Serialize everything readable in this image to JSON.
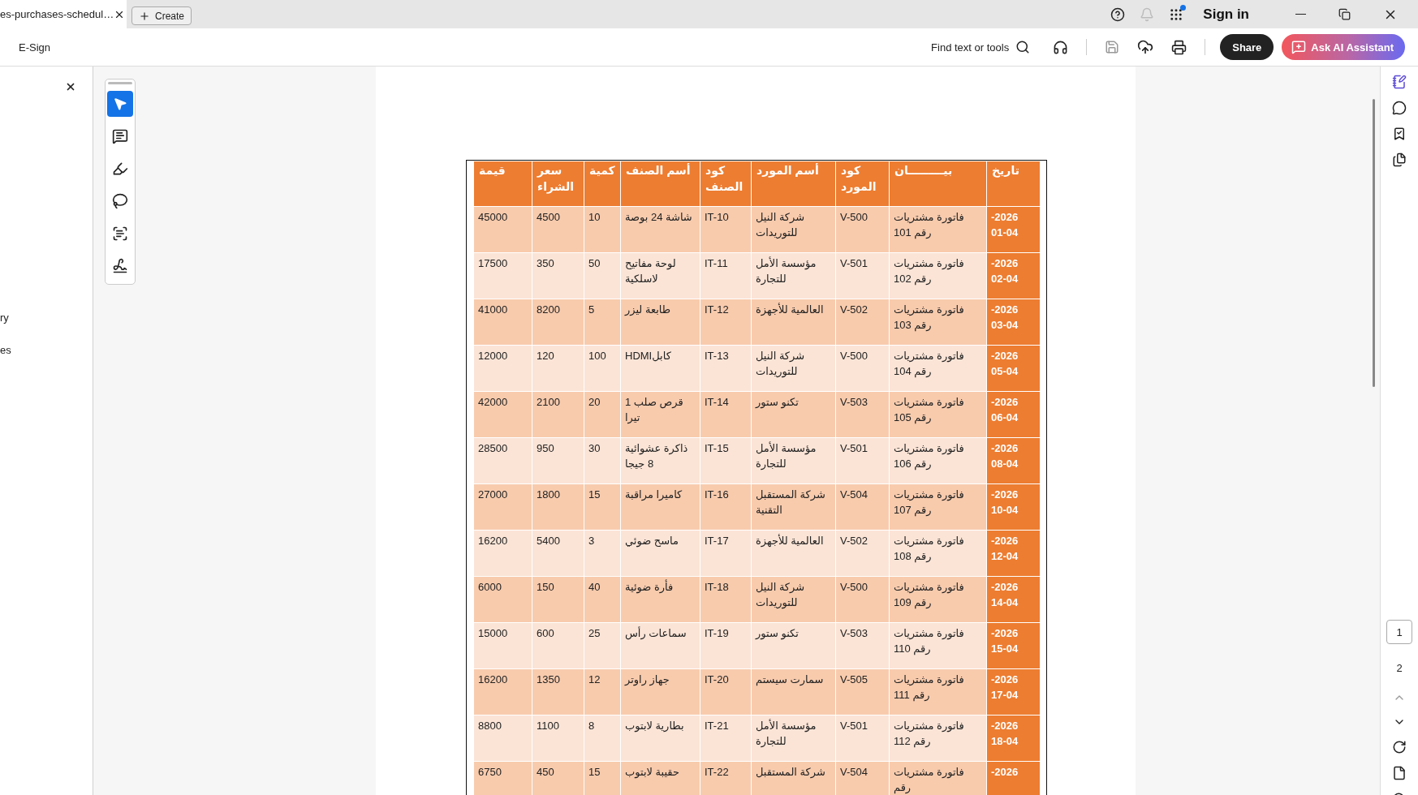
{
  "tab": {
    "title": "es-purchases-schedul…"
  },
  "create_button": {
    "label": "Create"
  },
  "account": {
    "sign_in": "Sign in"
  },
  "toolbar": {
    "e_sign": "E-Sign",
    "find": "Find text or tools",
    "share": "Share",
    "ai_assistant": "Ask AI Assistant"
  },
  "left_panel": {
    "items": [
      "ry",
      "es"
    ]
  },
  "tools": [
    {
      "kind": "select",
      "selected": true
    },
    {
      "kind": "comment",
      "selected": false
    },
    {
      "kind": "highlight",
      "selected": false
    },
    {
      "kind": "draw",
      "selected": false
    },
    {
      "kind": "text",
      "selected": false
    },
    {
      "kind": "sign",
      "selected": false
    }
  ],
  "table": {
    "columns": [
      "تاريخ",
      "بيـــــــــان",
      "كود المورد",
      "أسم المورد",
      "كود الصنف",
      "أسم الصنف",
      "كمية",
      "سعر الشراء",
      "قيمة"
    ],
    "rows": [
      {
        "cells": [
          "-2026 01-04",
          "فاتورة مشتريات رقم 101",
          "V-500",
          "شركة النيل للتوريدات",
          "IT-10",
          "شاشة 24 بوصة",
          "10",
          "4500",
          "45000"
        ]
      },
      {
        "cells": [
          "-2026 02-04",
          "فاتورة مشتريات رقم 102",
          "V-501",
          "مؤسسة الأمل للتجارة",
          "IT-11",
          "لوحة مفاتيح لاسلكية",
          "50",
          "350",
          "17500"
        ]
      },
      {
        "cells": [
          "-2026 03-04",
          "فاتورة مشتريات رقم 103",
          "V-502",
          "العالمية للأجهزة",
          "IT-12",
          "طابعة ليزر",
          "5",
          "8200",
          "41000"
        ]
      },
      {
        "cells": [
          "-2026 05-04",
          "فاتورة مشتريات رقم 104",
          "V-500",
          "شركة النيل للتوريدات",
          "IT-13",
          "HDMIكابل",
          "100",
          "120",
          "12000"
        ]
      },
      {
        "cells": [
          "-2026 06-04",
          "فاتورة مشتريات رقم 105",
          "V-503",
          "تكنو ستور",
          "IT-14",
          "قرص صلب 1 تيرا",
          "20",
          "2100",
          "42000"
        ]
      },
      {
        "cells": [
          "-2026 08-04",
          "فاتورة مشتريات رقم 106",
          "V-501",
          "مؤسسة الأمل للتجارة",
          "IT-15",
          "ذاكرة عشوائية 8 جيجا",
          "30",
          "950",
          "28500"
        ]
      },
      {
        "cells": [
          "-2026 10-04",
          "فاتورة مشتريات رقم 107",
          "V-504",
          "شركة المستقبل التقنية",
          "IT-16",
          "كاميرا مراقبة",
          "15",
          "1800",
          "27000"
        ]
      },
      {
        "cells": [
          "-2026 12-04",
          "فاتورة مشتريات رقم 108",
          "V-502",
          "العالمية للأجهزة",
          "IT-17",
          "ماسح ضوئي",
          "3",
          "5400",
          "16200"
        ]
      },
      {
        "cells": [
          "-2026 14-04",
          "فاتورة مشتريات رقم 109",
          "V-500",
          "شركة النيل للتوريدات",
          "IT-18",
          "فأرة ضوئية",
          "40",
          "150",
          "6000"
        ]
      },
      {
        "cells": [
          "-2026 15-04",
          "فاتورة مشتريات رقم 110",
          "V-503",
          "تكنو ستور",
          "IT-19",
          "سماعات رأس",
          "25",
          "600",
          "15000"
        ]
      },
      {
        "cells": [
          "-2026 17-04",
          "فاتورة مشتريات رقم 111",
          "V-505",
          "سمارت سيستم",
          "IT-20",
          "جهاز راوتر",
          "12",
          "1350",
          "16200"
        ]
      },
      {
        "cells": [
          "-2026 18-04",
          "فاتورة مشتريات رقم 112",
          "V-501",
          "مؤسسة الأمل للتجارة",
          "IT-21",
          "بطارية لابتوب",
          "8",
          "1100",
          "8800"
        ]
      },
      {
        "cells": [
          "-2026",
          "فاتورة مشتريات رقم",
          "V-504",
          "شركة المستقبل",
          "IT-22",
          "حقيبة لابتوب",
          "15",
          "450",
          "6750"
        ]
      }
    ]
  },
  "pages": [
    {
      "label": "1",
      "selected": true
    },
    {
      "label": "2",
      "selected": false
    }
  ]
}
